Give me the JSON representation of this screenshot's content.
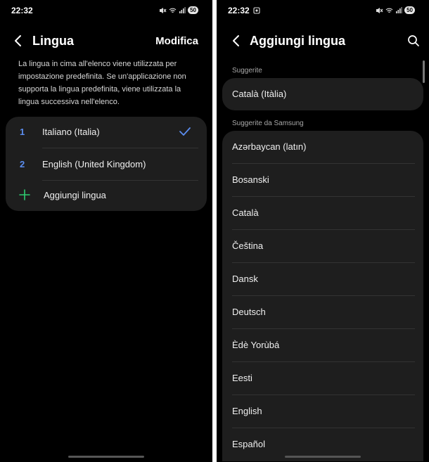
{
  "status": {
    "time": "22:32",
    "battery": "50"
  },
  "left": {
    "title": "Lingua",
    "action": "Modifica",
    "description": "La lingua in cima all'elenco viene utilizzata per impostazione predefinita. Se un'applicazione non supporta la lingua predefinita, viene utilizzata la lingua successiva nell'elenco.",
    "languages": [
      {
        "number": "1",
        "name": "Italiano (Italia)"
      },
      {
        "number": "2",
        "name": "English (United Kingdom)"
      }
    ],
    "add_label": "Aggiungi lingua"
  },
  "right": {
    "title": "Aggiungi lingua",
    "suggested_label": "Suggerite",
    "suggested": [
      "Català (Itàlia)"
    ],
    "samsung_label": "Suggerite da Samsung",
    "samsung": [
      "Azərbaycan (latın)",
      "Bosanski",
      "Català",
      "Čeština",
      "Dansk",
      "Deutsch",
      "Èdè Yorùbá",
      "Eesti",
      "English",
      "Español"
    ]
  },
  "colors": {
    "accent": "#5b8def",
    "add": "#2ecc71",
    "card": "#1e1e1e",
    "background": "#000000"
  }
}
